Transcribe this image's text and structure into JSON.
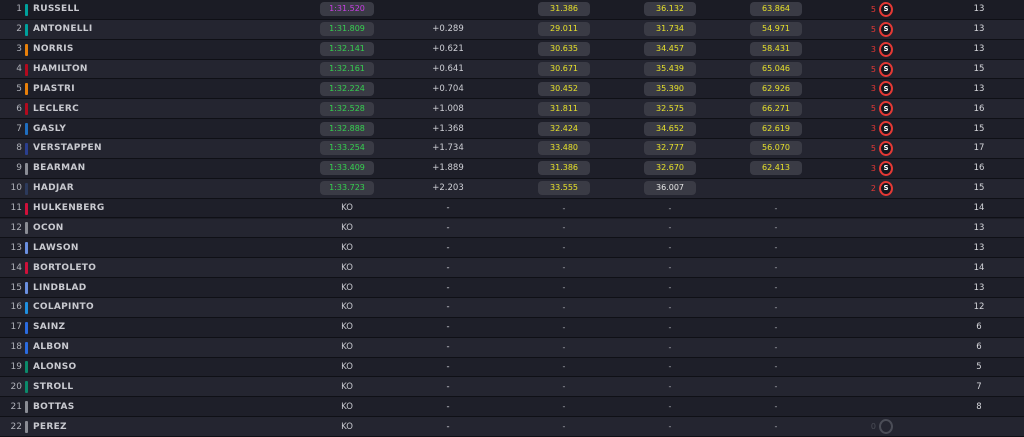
{
  "colors": {
    "background": "#1c1d26",
    "fastest_lap": "#c93ce6",
    "lap_time_green": "#35d14f",
    "sector_yellow": "#e8e22a",
    "tyre_soft": "#e53935"
  },
  "rows": [
    {
      "pos": "1",
      "name": "RUSSELL",
      "team_color": "#00a19c",
      "best": "1:31.520",
      "best_style": "purple",
      "gap": "",
      "s1": "31.386",
      "s1_style": "yellow",
      "s2": "36.132",
      "s2_style": "yellow",
      "s3": "63.864",
      "s3_style": "yellow",
      "stops": "5",
      "tyre": "S",
      "tyre_style": "soft",
      "laps": "13"
    },
    {
      "pos": "2",
      "name": "ANTONELLI",
      "team_color": "#00a19c",
      "best": "1:31.809",
      "best_style": "green",
      "gap": "+0.289",
      "s1": "29.011",
      "s1_style": "yellow",
      "s2": "31.734",
      "s2_style": "yellow",
      "s3": "54.971",
      "s3_style": "yellow",
      "stops": "5",
      "tyre": "S",
      "tyre_style": "soft",
      "laps": "13"
    },
    {
      "pos": "3",
      "name": "NORRIS",
      "team_color": "#e8800a",
      "best": "1:32.141",
      "best_style": "green",
      "gap": "+0.621",
      "s1": "30.635",
      "s1_style": "yellow",
      "s2": "34.457",
      "s2_style": "yellow",
      "s3": "58.431",
      "s3_style": "yellow",
      "stops": "3",
      "tyre": "S",
      "tyre_style": "soft",
      "laps": "13"
    },
    {
      "pos": "4",
      "name": "HAMILTON",
      "team_color": "#b30a1e",
      "best": "1:32.161",
      "best_style": "green",
      "gap": "+0.641",
      "s1": "30.671",
      "s1_style": "yellow",
      "s2": "35.439",
      "s2_style": "yellow",
      "s3": "65.046",
      "s3_style": "yellow",
      "stops": "5",
      "tyre": "S",
      "tyre_style": "soft",
      "laps": "15"
    },
    {
      "pos": "5",
      "name": "PIASTRI",
      "team_color": "#e8800a",
      "best": "1:32.224",
      "best_style": "green",
      "gap": "+0.704",
      "s1": "30.452",
      "s1_style": "yellow",
      "s2": "35.390",
      "s2_style": "yellow",
      "s3": "62.926",
      "s3_style": "yellow",
      "stops": "3",
      "tyre": "S",
      "tyre_style": "soft",
      "laps": "13"
    },
    {
      "pos": "6",
      "name": "LECLERC",
      "team_color": "#b30a1e",
      "best": "1:32.528",
      "best_style": "green",
      "gap": "+1.008",
      "s1": "31.811",
      "s1_style": "yellow",
      "s2": "32.575",
      "s2_style": "yellow",
      "s3": "66.271",
      "s3_style": "yellow",
      "stops": "5",
      "tyre": "S",
      "tyre_style": "soft",
      "laps": "16"
    },
    {
      "pos": "7",
      "name": "GASLY",
      "team_color": "#1f6ec0",
      "best": "1:32.888",
      "best_style": "green",
      "gap": "+1.368",
      "s1": "32.424",
      "s1_style": "yellow",
      "s2": "34.652",
      "s2_style": "yellow",
      "s3": "62.619",
      "s3_style": "yellow",
      "stops": "3",
      "tyre": "S",
      "tyre_style": "soft",
      "laps": "15"
    },
    {
      "pos": "8",
      "name": "VERSTAPPEN",
      "team_color": "#2a3f8f",
      "best": "1:33.254",
      "best_style": "green",
      "gap": "+1.734",
      "s1": "33.480",
      "s1_style": "yellow",
      "s2": "32.777",
      "s2_style": "yellow",
      "s3": "56.070",
      "s3_style": "yellow",
      "stops": "5",
      "tyre": "S",
      "tyre_style": "soft",
      "laps": "17"
    },
    {
      "pos": "9",
      "name": "BEARMAN",
      "team_color": "#8a8c94",
      "best": "1:33.409",
      "best_style": "green",
      "gap": "+1.889",
      "s1": "31.386",
      "s1_style": "yellow",
      "s2": "32.670",
      "s2_style": "yellow",
      "s3": "62.413",
      "s3_style": "yellow",
      "stops": "3",
      "tyre": "S",
      "tyre_style": "soft",
      "laps": "16"
    },
    {
      "pos": "10",
      "name": "HADJAR",
      "team_color": "#2c3a5c",
      "best": "1:33.723",
      "best_style": "green",
      "gap": "+2.203",
      "s1": "33.555",
      "s1_style": "yellow",
      "s2": "36.007",
      "s2_style": "white",
      "s3": "",
      "s3_style": "none",
      "stops": "2",
      "tyre": "S",
      "tyre_style": "soft",
      "laps": "15"
    },
    {
      "pos": "11",
      "name": "HULKENBERG",
      "team_color": "#d0103a",
      "best": "KO",
      "best_style": "plain",
      "gap": "-",
      "s1": "-",
      "s1_style": "dash",
      "s2": "-",
      "s2_style": "dash",
      "s3": "-",
      "s3_style": "dash",
      "stops": "",
      "tyre": "",
      "tyre_style": "none",
      "laps": "14"
    },
    {
      "pos": "12",
      "name": "OCON",
      "team_color": "#8a8c94",
      "best": "KO",
      "best_style": "plain",
      "gap": "-",
      "s1": "-",
      "s1_style": "dash",
      "s2": "-",
      "s2_style": "dash",
      "s3": "-",
      "s3_style": "dash",
      "stops": "",
      "tyre": "",
      "tyre_style": "none",
      "laps": "13"
    },
    {
      "pos": "13",
      "name": "LAWSON",
      "team_color": "#6a8fe0",
      "best": "KO",
      "best_style": "plain",
      "gap": "-",
      "s1": "-",
      "s1_style": "dash",
      "s2": "-",
      "s2_style": "dash",
      "s3": "-",
      "s3_style": "dash",
      "stops": "",
      "tyre": "",
      "tyre_style": "none",
      "laps": "13"
    },
    {
      "pos": "14",
      "name": "BORTOLETO",
      "team_color": "#d0103a",
      "best": "KO",
      "best_style": "plain",
      "gap": "-",
      "s1": "-",
      "s1_style": "dash",
      "s2": "-",
      "s2_style": "dash",
      "s3": "-",
      "s3_style": "dash",
      "stops": "",
      "tyre": "",
      "tyre_style": "none",
      "laps": "14"
    },
    {
      "pos": "15",
      "name": "LINDBLAD",
      "team_color": "#6a8fe0",
      "best": "KO",
      "best_style": "plain",
      "gap": "-",
      "s1": "-",
      "s1_style": "dash",
      "s2": "-",
      "s2_style": "dash",
      "s3": "-",
      "s3_style": "dash",
      "stops": "",
      "tyre": "",
      "tyre_style": "none",
      "laps": "13"
    },
    {
      "pos": "16",
      "name": "COLAPINTO",
      "team_color": "#1f8fe0",
      "best": "KO",
      "best_style": "plain",
      "gap": "-",
      "s1": "-",
      "s1_style": "dash",
      "s2": "-",
      "s2_style": "dash",
      "s3": "-",
      "s3_style": "dash",
      "stops": "",
      "tyre": "",
      "tyre_style": "none",
      "laps": "12"
    },
    {
      "pos": "17",
      "name": "SAINZ",
      "team_color": "#2a6be0",
      "best": "KO",
      "best_style": "plain",
      "gap": "-",
      "s1": "-",
      "s1_style": "dash",
      "s2": "-",
      "s2_style": "dash",
      "s3": "-",
      "s3_style": "dash",
      "stops": "",
      "tyre": "",
      "tyre_style": "none",
      "laps": "6"
    },
    {
      "pos": "18",
      "name": "ALBON",
      "team_color": "#2a6be0",
      "best": "KO",
      "best_style": "plain",
      "gap": "-",
      "s1": "-",
      "s1_style": "dash",
      "s2": "-",
      "s2_style": "dash",
      "s3": "-",
      "s3_style": "dash",
      "stops": "",
      "tyre": "",
      "tyre_style": "none",
      "laps": "6"
    },
    {
      "pos": "19",
      "name": "ALONSO",
      "team_color": "#0b8a6a",
      "best": "KO",
      "best_style": "plain",
      "gap": "-",
      "s1": "-",
      "s1_style": "dash",
      "s2": "-",
      "s2_style": "dash",
      "s3": "-",
      "s3_style": "dash",
      "stops": "",
      "tyre": "",
      "tyre_style": "none",
      "laps": "5"
    },
    {
      "pos": "20",
      "name": "STROLL",
      "team_color": "#0b8a6a",
      "best": "KO",
      "best_style": "plain",
      "gap": "-",
      "s1": "-",
      "s1_style": "dash",
      "s2": "-",
      "s2_style": "dash",
      "s3": "-",
      "s3_style": "dash",
      "stops": "",
      "tyre": "",
      "tyre_style": "none",
      "laps": "7"
    },
    {
      "pos": "21",
      "name": "BOTTAS",
      "team_color": "#8a8c94",
      "best": "KO",
      "best_style": "plain",
      "gap": "-",
      "s1": "-",
      "s1_style": "dash",
      "s2": "-",
      "s2_style": "dash",
      "s3": "-",
      "s3_style": "dash",
      "stops": "",
      "tyre": "",
      "tyre_style": "none",
      "laps": "8"
    },
    {
      "pos": "22",
      "name": "PEREZ",
      "team_color": "#8a8c94",
      "best": "KO",
      "best_style": "plain",
      "gap": "-",
      "s1": "-",
      "s1_style": "dash",
      "s2": "-",
      "s2_style": "dash",
      "s3": "-",
      "s3_style": "dash",
      "stops": "0",
      "stops_style": "grey",
      "tyre": "",
      "tyre_style": "grey",
      "laps": ""
    }
  ]
}
